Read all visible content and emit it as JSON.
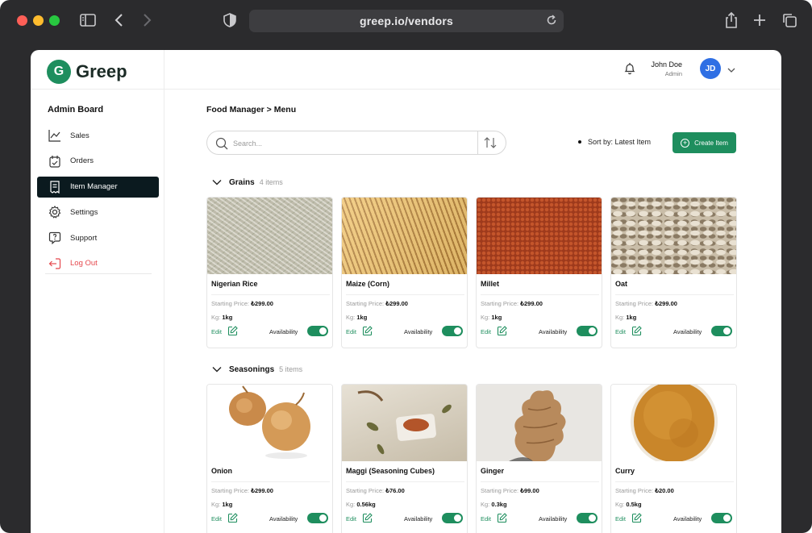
{
  "browser": {
    "url": "greep.io/vendors"
  },
  "brand": {
    "logo_letter": "G",
    "name": "Greep",
    "accent": "#1e8e5e"
  },
  "sidebar": {
    "title": "Admin Board",
    "items": [
      {
        "label": "Sales",
        "icon": "chart-line-icon"
      },
      {
        "label": "Orders",
        "icon": "calendar-icon"
      },
      {
        "label": "Item Manager",
        "icon": "receipt-icon",
        "active": true
      },
      {
        "label": "Settings",
        "icon": "gear-icon"
      },
      {
        "label": "Support",
        "icon": "help-chat-icon"
      },
      {
        "label": "Log Out",
        "icon": "logout-icon",
        "color": "#e5484d"
      }
    ]
  },
  "header": {
    "user_name": "John Doe",
    "user_role": "Admin",
    "avatar_initials": "JD",
    "avatar_color": "#2f6fe4"
  },
  "main": {
    "breadcrumb": "Food Manager > Menu",
    "search_placeholder": "Search...",
    "sort_label": "Sort by: Latest Item",
    "create_label": "Create Item",
    "categories": [
      {
        "name": "Grains",
        "count": "4 items",
        "items": [
          {
            "name": "Nigerian Rice",
            "price": "₺299.00",
            "kg": "1kg",
            "available": true
          },
          {
            "name": "Maize (Corn)",
            "price": "₺299.00",
            "kg": "1kg",
            "available": true
          },
          {
            "name": "Millet",
            "price": "₺299.00",
            "kg": "1kg",
            "available": true
          },
          {
            "name": "Oat",
            "price": "₺299.00",
            "kg": "1kg",
            "available": true
          }
        ]
      },
      {
        "name": "Seasonings",
        "count": "5 items",
        "items": [
          {
            "name": "Onion",
            "price": "₺299.00",
            "kg": "1kg",
            "available": true
          },
          {
            "name": "Maggi (Seasoning Cubes)",
            "price": "₺76.00",
            "kg": "0.56kg",
            "available": true
          },
          {
            "name": "Ginger",
            "price": "₺99.00",
            "kg": "0.3kg",
            "available": true
          },
          {
            "name": "Curry",
            "price": "₺20.00",
            "kg": "0.5kg",
            "available": true
          }
        ]
      }
    ],
    "card_labels": {
      "price_label": "Starting Price:",
      "kg_label": "Kg:",
      "edit_label": "Edit",
      "availability_label": "Availability"
    }
  }
}
